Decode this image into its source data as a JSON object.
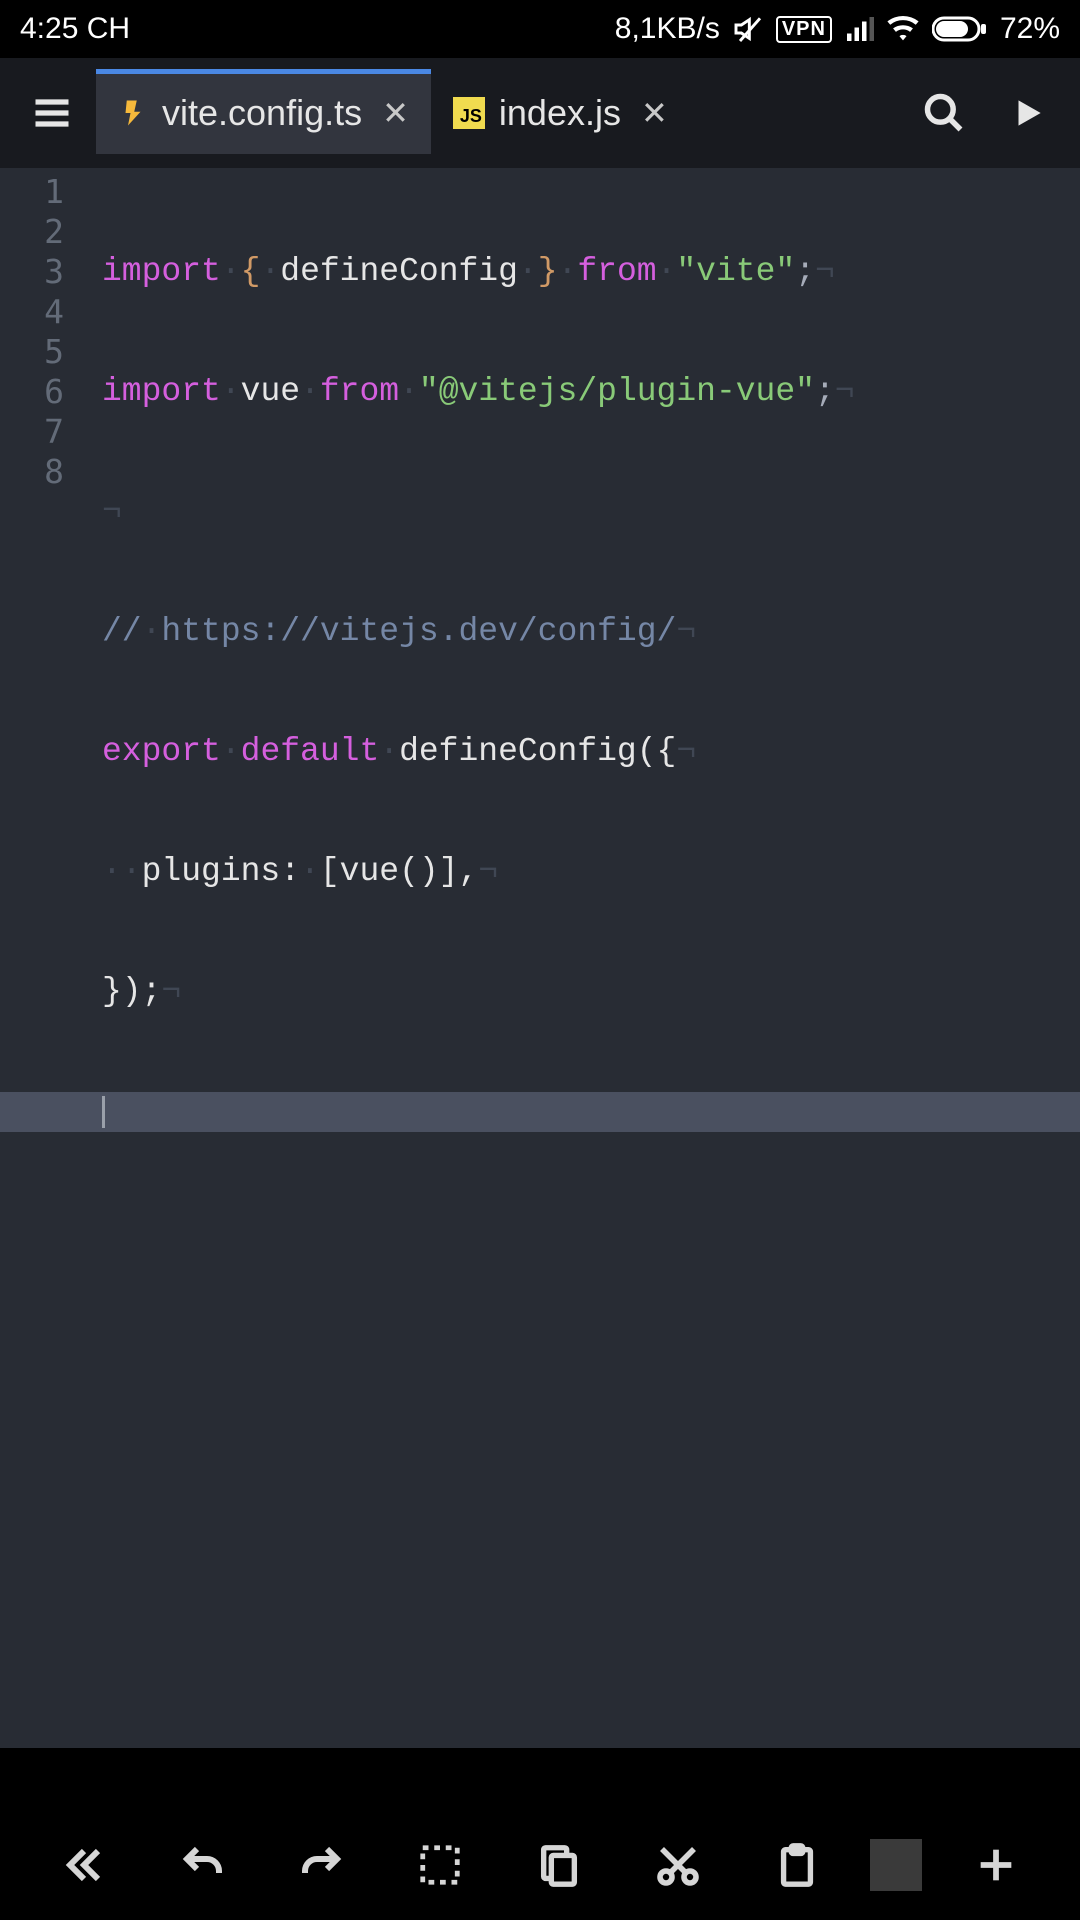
{
  "status": {
    "time": "4:25 CH",
    "speed": "8,1KB/s",
    "vpn": "VPN",
    "battery": "72%"
  },
  "tabs": [
    {
      "icon": "vite",
      "label": "vite.config.ts",
      "active": true
    },
    {
      "icon": "js",
      "label": "index.js",
      "active": false
    }
  ],
  "gutter": [
    "1",
    "2",
    "3",
    "4",
    "5",
    "6",
    "7",
    "8"
  ],
  "code": {
    "l1": {
      "a": "import",
      "b": "{",
      "c": "defineConfig",
      "d": "}",
      "e": "from",
      "f": "\"vite\"",
      "g": ";"
    },
    "l2": {
      "a": "import",
      "b": "vue",
      "c": "from",
      "d": "\"@vitejs/plugin-vue\"",
      "e": ";"
    },
    "l4": {
      "a": "//",
      "b": "https://vitejs.dev/config/"
    },
    "l5": {
      "a": "export",
      "b": "default",
      "c": "defineConfig({"
    },
    "l6": {
      "a": "plugins:",
      "b": "[vue()],"
    },
    "l7": {
      "a": "});"
    }
  },
  "ws": {
    "dot": "·",
    "eol": "¬",
    "dot2": "··"
  }
}
